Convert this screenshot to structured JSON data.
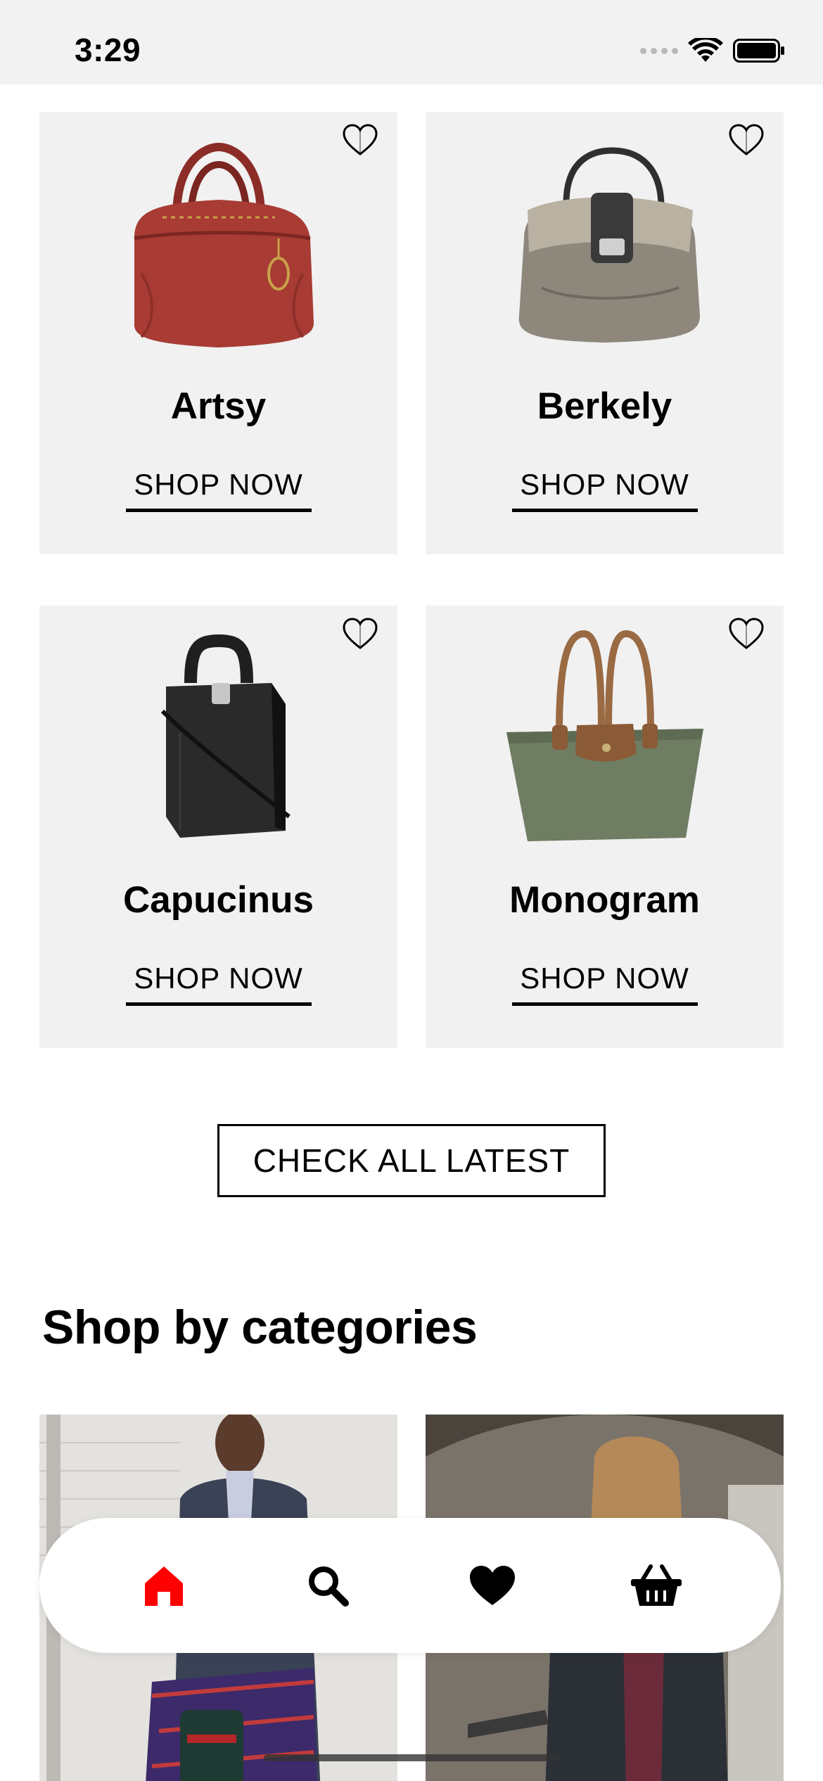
{
  "status_bar": {
    "time": "3:29"
  },
  "products": [
    {
      "name": "Artsy",
      "cta": "SHOP NOW",
      "color": "#a83b34"
    },
    {
      "name": "Berkely",
      "cta": "SHOP NOW",
      "color": "#8d877c"
    },
    {
      "name": "Capucinus",
      "cta": "SHOP NOW",
      "color": "#222222"
    },
    {
      "name": "Monogram",
      "cta": "SHOP NOW",
      "color": "#6f7d62"
    }
  ],
  "check_all_label": "CHECK ALL LATEST",
  "section_title": "Shop by categories",
  "bottom_nav": {
    "items": [
      {
        "icon": "home-icon",
        "active": true
      },
      {
        "icon": "search-icon",
        "active": false
      },
      {
        "icon": "heart-icon",
        "active": false
      },
      {
        "icon": "basket-icon",
        "active": false
      }
    ],
    "active_color": "#ff0000"
  }
}
